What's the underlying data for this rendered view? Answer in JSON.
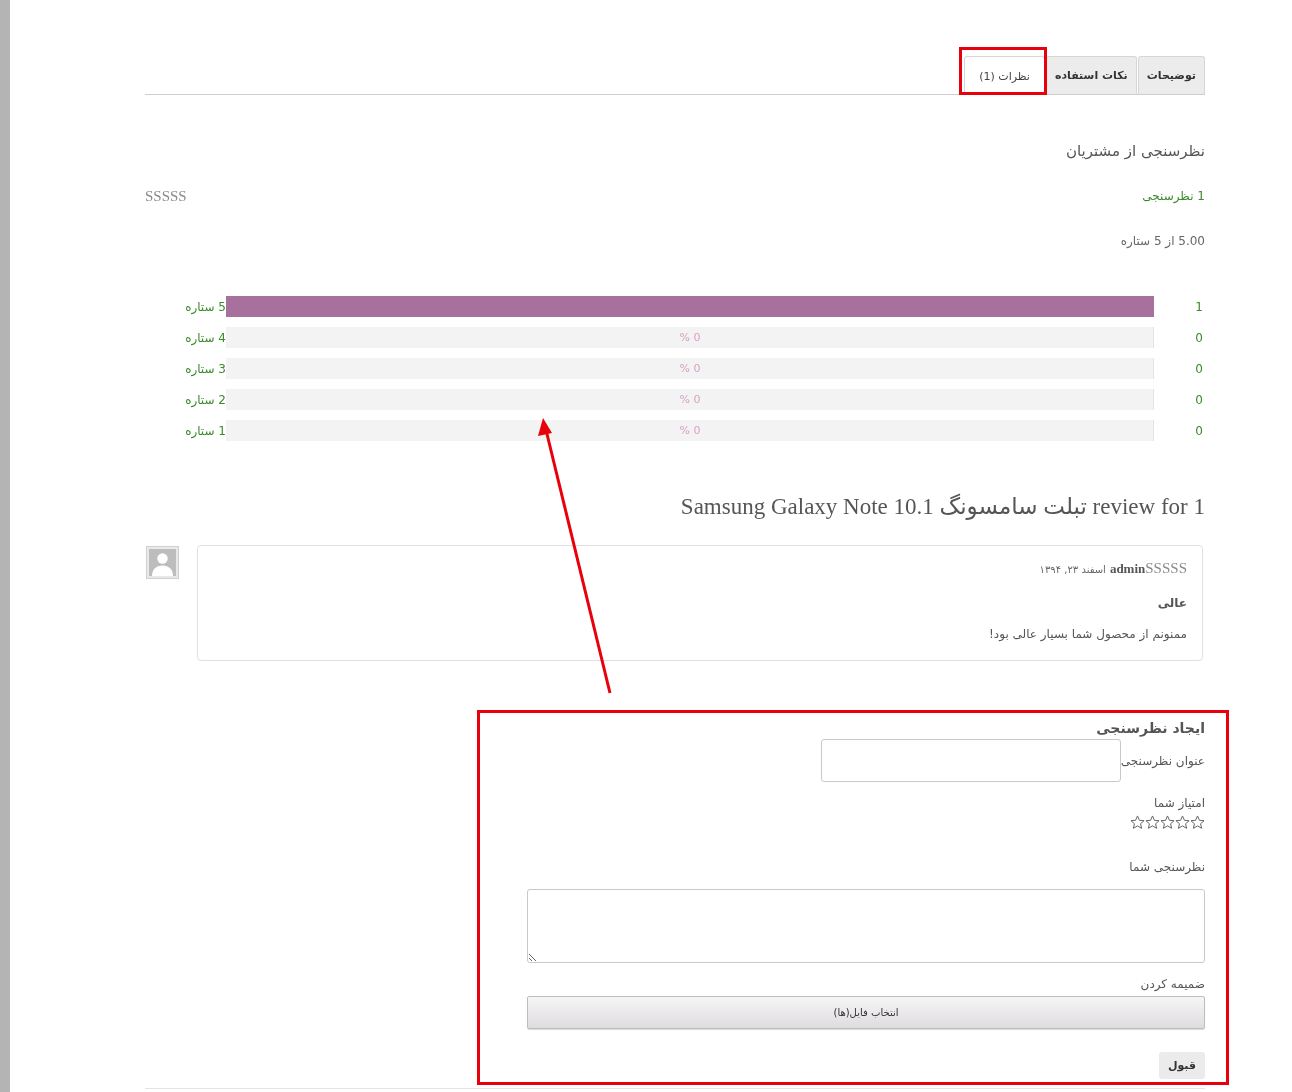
{
  "tabs": [
    {
      "label": "توضیحات",
      "selected": false
    },
    {
      "label": "نکات استفاده",
      "selected": false
    },
    {
      "label": "نظرات (1)",
      "selected": true
    }
  ],
  "summary": {
    "title": "نظرسنجی از مشتریان",
    "review_count": "1 نظرسنجی",
    "star_rating": "SSSSS",
    "average": "5.00 از 5 ستاره"
  },
  "rating_bars": [
    {
      "count": "1",
      "level": 1,
      "label": "5 ستاره"
    },
    {
      "count": "0",
      "level": 0,
      "percent": "0 %",
      "label": "4 ستاره"
    },
    {
      "count": "0",
      "level": 0,
      "percent": "0 %",
      "label": "3 ستاره"
    },
    {
      "count": "0",
      "level": 0,
      "percent": "0 %",
      "label": "2 ستاره"
    },
    {
      "count": "0",
      "level": 0,
      "percent": "0 %",
      "label": "1 ستاره"
    }
  ],
  "reviews": {
    "title": "1 review for تبلت سامسونگ Samsung Galaxy Note 10.1",
    "items": [
      {
        "star_rating": "SSSSS",
        "author": "admin",
        "date": "اسفند ۲۳, ۱۳۹۴",
        "title": "عالی",
        "text": "ممنونم از محصول شما بسیار عالی بود!"
      }
    ]
  },
  "review_form": {
    "title": "ایجاد نظرسنجی",
    "fields": [
      {
        "kind": "text",
        "label": "عنوان نظرسنجی"
      },
      {
        "kind": "rating",
        "label": "امتیاز شما",
        "stars": 0
      },
      {
        "kind": "textarea",
        "label": "نظرسنجی شما"
      },
      {
        "kind": "file",
        "label": "ضمیمه کردن",
        "button": "انتخاب فایل(ها)"
      }
    ],
    "submit": "قبول"
  }
}
